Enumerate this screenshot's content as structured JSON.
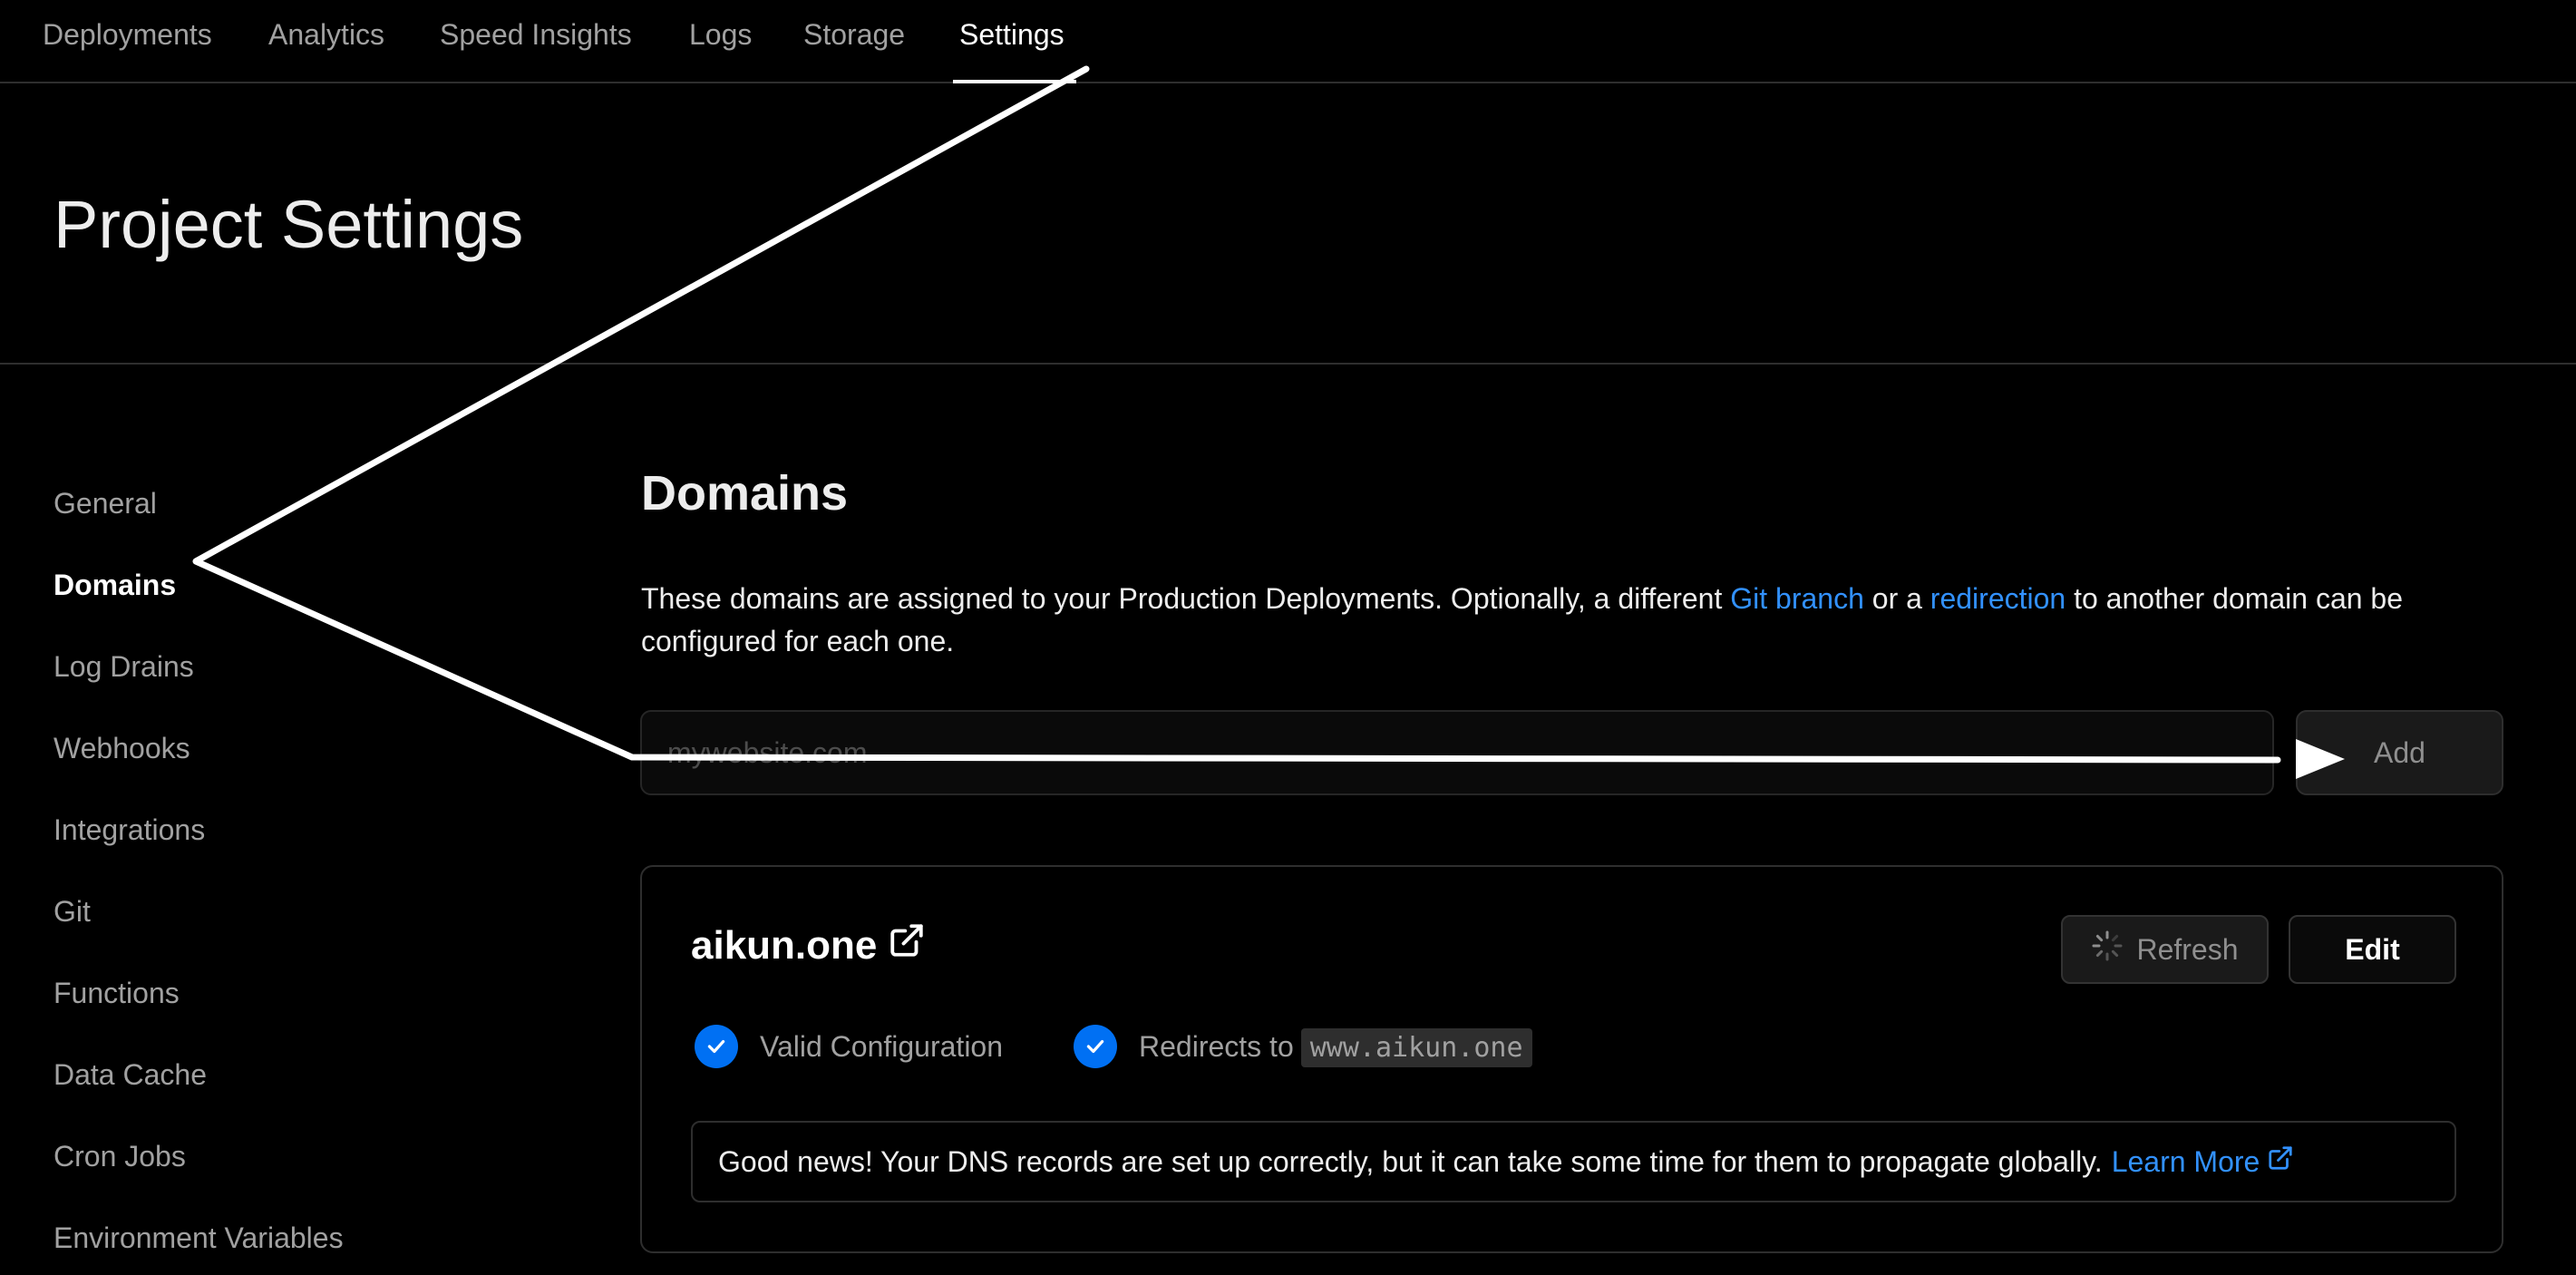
{
  "top_nav": {
    "tabs": [
      "Deployments",
      "Analytics",
      "Speed Insights",
      "Logs",
      "Storage",
      "Settings"
    ],
    "active_tab": "Settings"
  },
  "header": {
    "title": "Project Settings"
  },
  "sidebar": {
    "items": [
      "General",
      "Domains",
      "Log Drains",
      "Webhooks",
      "Integrations",
      "Git",
      "Functions",
      "Data Cache",
      "Cron Jobs",
      "Environment Variables"
    ],
    "active_item": "Domains"
  },
  "domains": {
    "title": "Domains",
    "description": {
      "part1": "These domains are assigned to your Production Deployments. Optionally, a different ",
      "link1": "Git branch",
      "part2": " or a ",
      "link2": "redirection",
      "part3": " to another domain can be configured for each one."
    },
    "input_placeholder": "mywebsite.com",
    "add_label": "Add"
  },
  "domain_card": {
    "name": "aikun.one",
    "refresh_label": "Refresh",
    "edit_label": "Edit",
    "status_valid": "Valid Configuration",
    "redirect_label": "Redirects to",
    "redirect_target": "www.aikun.one",
    "info_text": "Good news! Your DNS records are set up correctly, but it can take some time for them to propagate globally.",
    "learn_more": "Learn More"
  },
  "colors": {
    "background": "#000000",
    "link": "#3291ff",
    "check": "#0070f3",
    "border": "#2e2e2e"
  },
  "icons": [
    "external-link-icon",
    "spinner-icon",
    "check-icon"
  ]
}
